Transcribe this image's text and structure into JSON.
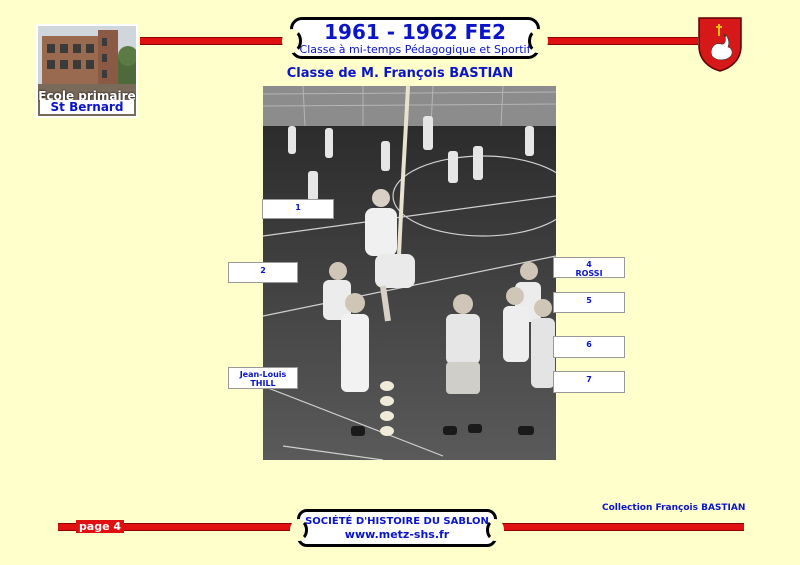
{
  "header": {
    "title": "1961 - 1962 FE2",
    "subtitle": "Classe à mi-temps Pédagogique et Sportif",
    "class_title": "Classe de M. François BASTIAN"
  },
  "school": {
    "line1": "Ecole primaire",
    "line2": "St Bernard"
  },
  "labels": [
    {
      "id": "1",
      "name": ""
    },
    {
      "id": "2",
      "name": ""
    },
    {
      "id": "4",
      "name": "ROSSI"
    },
    {
      "id": "5",
      "name": ""
    },
    {
      "id": "6",
      "name": ""
    },
    {
      "id": "7",
      "name": ""
    },
    {
      "id": "Jean-Louis",
      "name": "THILL"
    }
  ],
  "credit": "Collection François BASTIAN",
  "footer": {
    "page": "page 4",
    "org": "SOCIÉTÉ D'HISTOIRE DU SABLON",
    "url": "www.metz-shs.fr"
  },
  "colors": {
    "background": "#ffffcc",
    "accent_red": "#e01010",
    "text_blue": "#0a14c8"
  }
}
